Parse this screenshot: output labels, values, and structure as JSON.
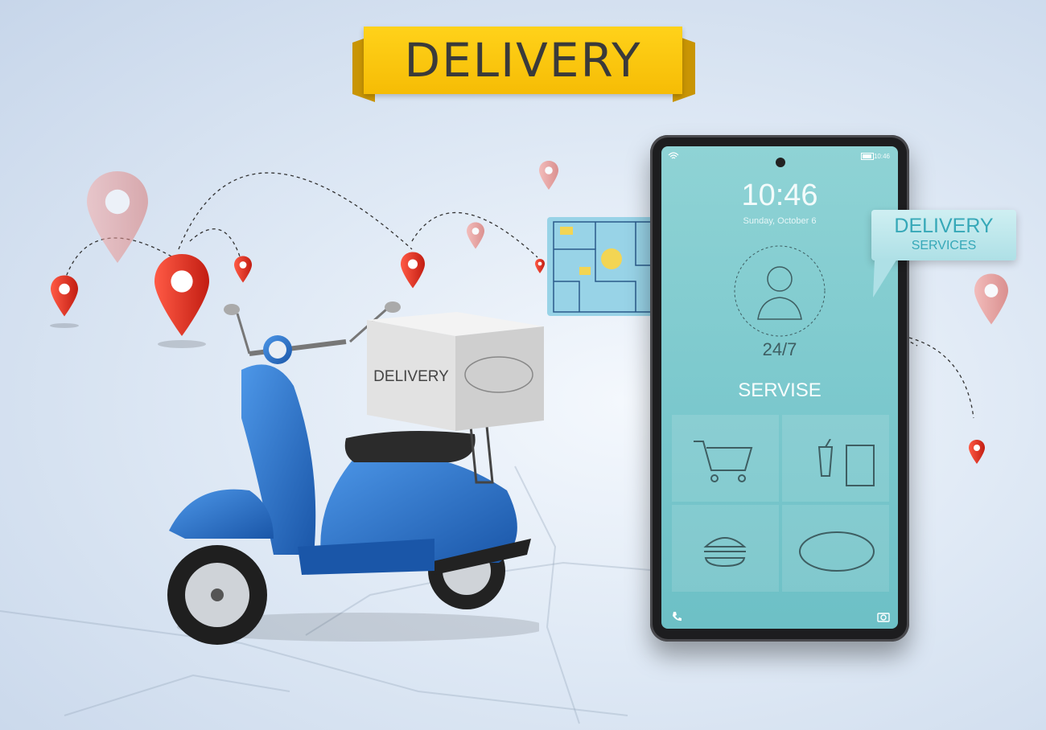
{
  "banner": {
    "title": "DELIVERY"
  },
  "box": {
    "label": "DELIVERY"
  },
  "phone": {
    "clock": "10:46",
    "date": "Sunday, October 6",
    "status_time": "10:46",
    "support_hours": "24/7",
    "service_label": "SERVISE"
  },
  "bubble": {
    "line1": "DELIVERY",
    "line2": "SERVICES"
  },
  "colors": {
    "ribbon": "#f6bc05",
    "scooter": "#2a72c8",
    "pin": "#e8382a",
    "screen": "#79c7cc"
  },
  "icons": [
    "location-pin-icon",
    "cart-icon",
    "drink-icon",
    "bag-icon",
    "burger-icon",
    "pizza-icon",
    "phone-icon",
    "camera-icon",
    "operator-icon",
    "wifi-icon",
    "battery-icon"
  ]
}
